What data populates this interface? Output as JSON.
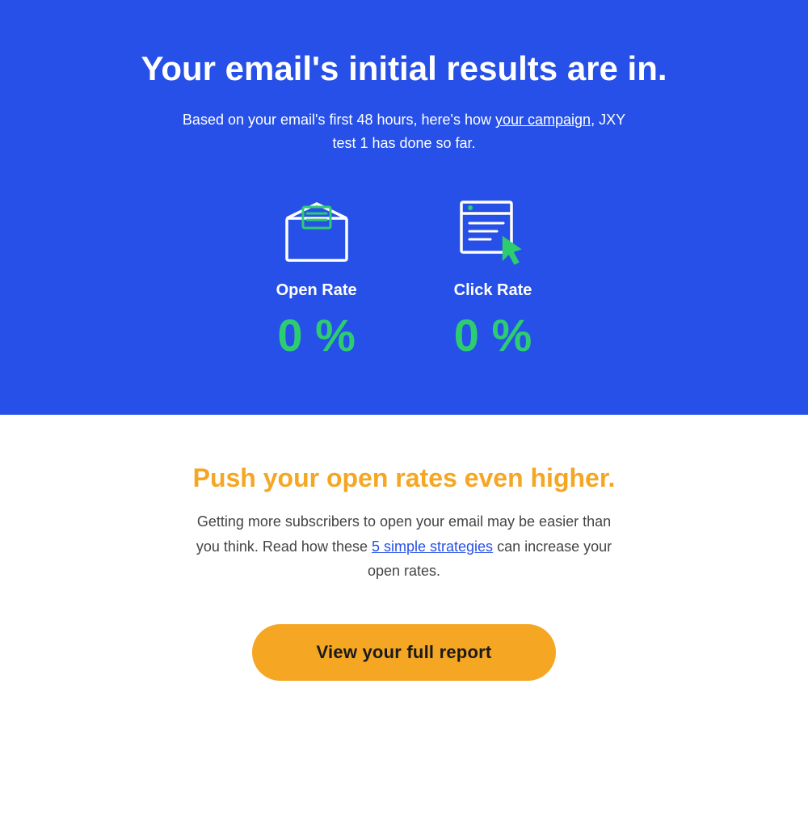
{
  "hero": {
    "title": "Your email's initial results are in.",
    "subtitle_before_link": "Based on your email's first 48 hours, here's how ",
    "subtitle_link_text": "your campaign",
    "subtitle_after_link": ", JXY test 1 has done so far.",
    "campaign_link_url": "#"
  },
  "metrics": [
    {
      "id": "open-rate",
      "icon": "open-rate-icon",
      "label": "Open Rate",
      "value": "0",
      "unit": "%"
    },
    {
      "id": "click-rate",
      "icon": "click-rate-icon",
      "label": "Click Rate",
      "value": "0",
      "unit": "%"
    }
  ],
  "content": {
    "title": "Push your open rates even higher.",
    "body_before_link": "Getting more subscribers to open your email may be easier than you think. Read how these ",
    "body_link_text": "5 simple strategies",
    "body_after_link": " can increase your open rates.",
    "link_url": "#",
    "cta_label": "View your full report",
    "cta_url": "#"
  },
  "colors": {
    "hero_bg": "#2650e8",
    "metric_value": "#2ecc71",
    "title_orange": "#f5a623",
    "cta_bg": "#f5a623",
    "body_text": "#444444",
    "link_blue": "#2650e8"
  }
}
